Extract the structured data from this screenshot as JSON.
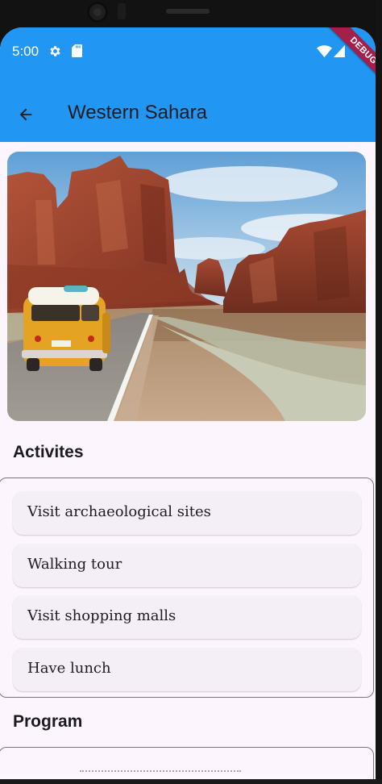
{
  "status_bar": {
    "time": "5:00",
    "icons": [
      "gear-icon",
      "sd-card-icon",
      "wifi-icon",
      "signal-icon"
    ],
    "debug_banner": "DEBUG"
  },
  "app_bar": {
    "back_icon": "arrow-back-icon",
    "title": "Western Sahara",
    "color": "#2196f3"
  },
  "hero_image": {
    "description": "photo-hero"
  },
  "activities": {
    "title": "Activites",
    "items": [
      {
        "label": "Visit archaeological sites"
      },
      {
        "label": "Walking tour"
      },
      {
        "label": "Visit shopping malls"
      },
      {
        "label": "Have lunch"
      }
    ]
  },
  "program": {
    "title": "Program"
  },
  "colors": {
    "background": "#fcf5fd",
    "card": "#f4eef7",
    "text": "#1d1b20"
  }
}
